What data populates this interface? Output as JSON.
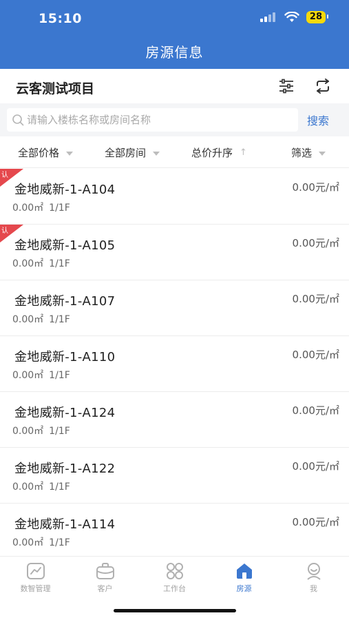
{
  "status": {
    "time": "15:10",
    "battery": "28"
  },
  "header": {
    "title": "房源信息"
  },
  "project": {
    "name": "云客测试项目"
  },
  "search": {
    "placeholder": "请输入楼栋名称或房间名称",
    "button": "搜索"
  },
  "filters": [
    "全部价格",
    "全部房间",
    "总价升序",
    "筛选"
  ],
  "rows": [
    {
      "title": "金地威新-1-A104",
      "price": "0.00元/㎡",
      "area": "0.00㎡",
      "floor": "1/1F",
      "tag": "认"
    },
    {
      "title": "金地威新-1-A105",
      "price": "0.00元/㎡",
      "area": "0.00㎡",
      "floor": "1/1F",
      "tag": "认"
    },
    {
      "title": "金地威新-1-A107",
      "price": "0.00元/㎡",
      "area": "0.00㎡",
      "floor": "1/1F",
      "tag": ""
    },
    {
      "title": "金地威新-1-A110",
      "price": "0.00元/㎡",
      "area": "0.00㎡",
      "floor": "1/1F",
      "tag": ""
    },
    {
      "title": "金地威新-1-A124",
      "price": "0.00元/㎡",
      "area": "0.00㎡",
      "floor": "1/1F",
      "tag": ""
    },
    {
      "title": "金地威新-1-A122",
      "price": "0.00元/㎡",
      "area": "0.00㎡",
      "floor": "1/1F",
      "tag": ""
    },
    {
      "title": "金地威新-1-A114",
      "price": "0.00元/㎡",
      "area": "0.00㎡",
      "floor": "1/1F",
      "tag": ""
    }
  ],
  "tabs": [
    {
      "label": "数智管理",
      "icon": "chart-icon"
    },
    {
      "label": "客户",
      "icon": "briefcase-icon"
    },
    {
      "label": "工作台",
      "icon": "grid-icon"
    },
    {
      "label": "房源",
      "icon": "house-icon"
    },
    {
      "label": "我",
      "icon": "user-icon"
    }
  ],
  "colors": {
    "brand": "#3b77cf",
    "tag": "#e5484d"
  }
}
